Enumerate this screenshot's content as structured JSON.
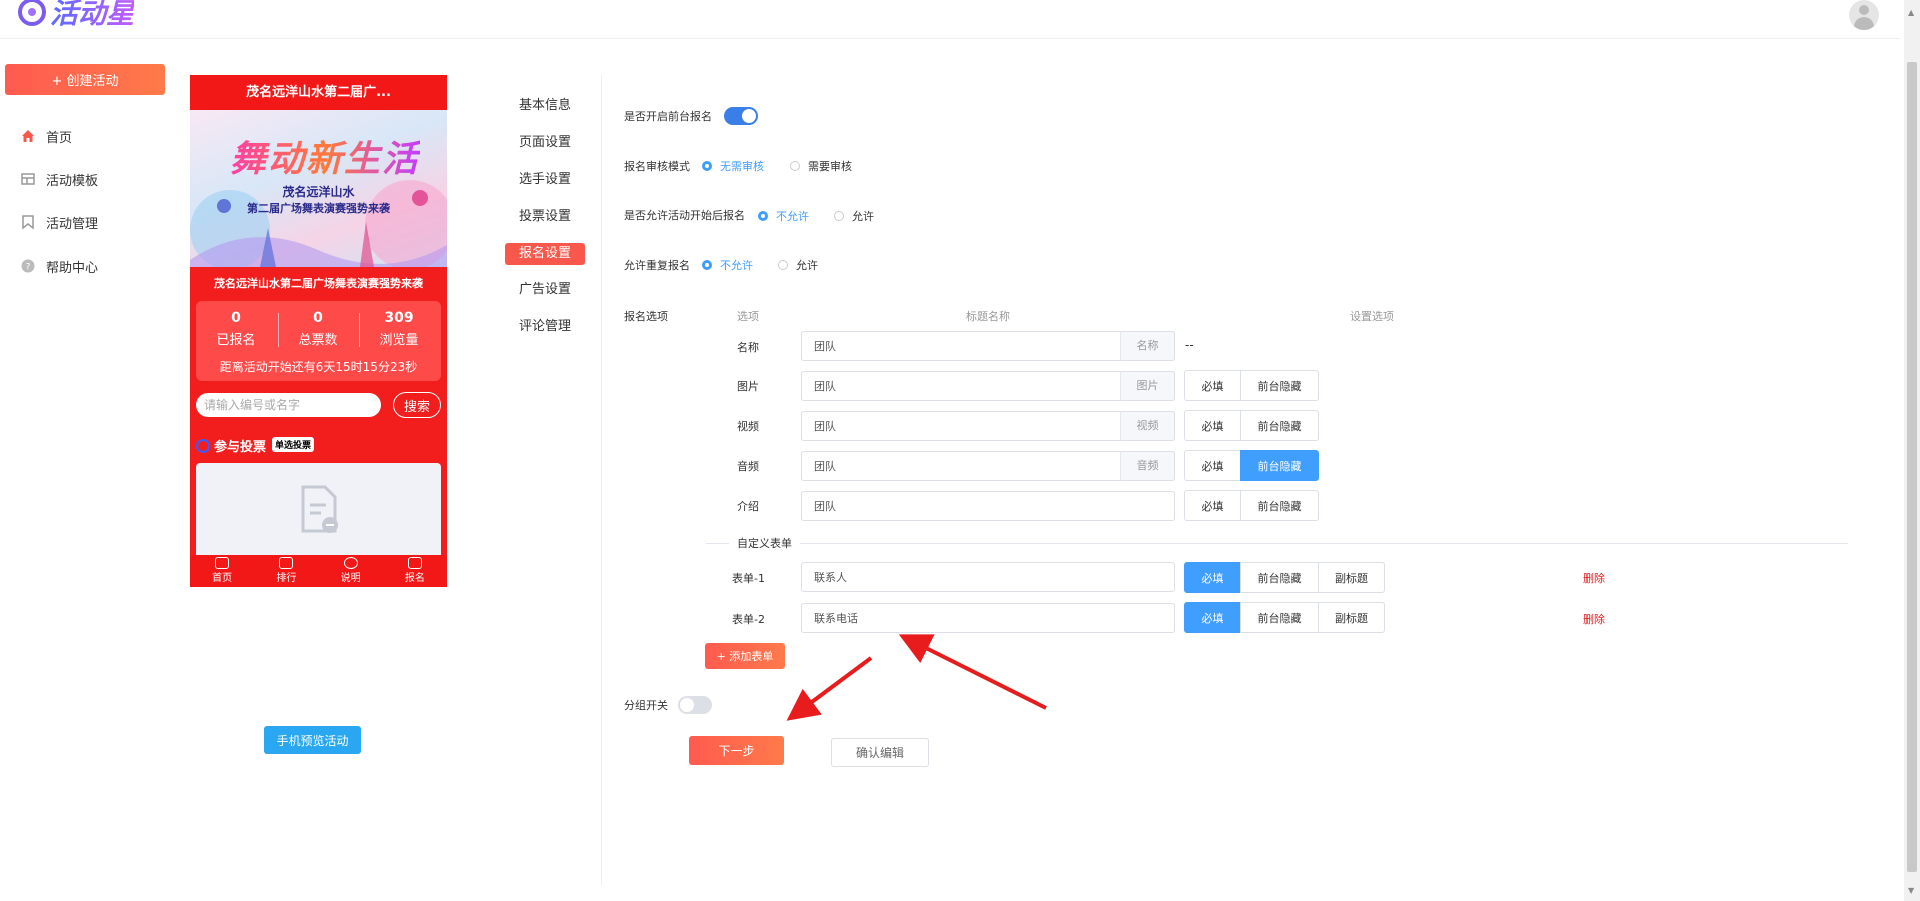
{
  "app": {
    "logo_text": "活动星"
  },
  "sidebar": {
    "create_button": "+ 创建活动",
    "items": [
      {
        "label": "首页",
        "icon": "home-icon"
      },
      {
        "label": "活动模板",
        "icon": "template-icon"
      },
      {
        "label": "活动管理",
        "icon": "bookmark-icon"
      },
      {
        "label": "帮助中心",
        "icon": "help-icon"
      }
    ]
  },
  "preview": {
    "title": "茂名远洋山水第二届广...",
    "banner_slogan": "舞动新生活",
    "banner_line1": "茂名远洋山水",
    "banner_line2": "第二届广场舞表演赛强势来袭",
    "event_name": "茂名远洋山水第二届广场舞表演赛强势来袭",
    "stats": [
      {
        "value": "0",
        "label": "已报名"
      },
      {
        "value": "0",
        "label": "总票数"
      },
      {
        "value": "309",
        "label": "浏览量"
      }
    ],
    "countdown": "距离活动开始还有6天15时15分23秒",
    "search_placeholder": "请输入编号或名字",
    "search_button": "搜索",
    "vote_title": "参与投票",
    "vote_tag": "单选投票",
    "tabs": [
      "首页",
      "排行",
      "说明",
      "报名"
    ],
    "preview_button": "手机预览活动"
  },
  "settings_menu": {
    "items": [
      "基本信息",
      "页面设置",
      "选手设置",
      "投票设置",
      "报名设置",
      "广告设置",
      "评论管理"
    ],
    "active": "报名设置"
  },
  "form": {
    "frontend_signup": {
      "label": "是否开启前台报名",
      "enabled": true
    },
    "review_mode": {
      "label": "报名审核模式",
      "options": [
        "无需审核",
        "需要审核"
      ],
      "selected": "无需审核"
    },
    "allow_after_start": {
      "label": "是否允许活动开始后报名",
      "options": [
        "不允许",
        "允许"
      ],
      "selected": "不允许"
    },
    "allow_repeat": {
      "label": "允许重复报名",
      "options": [
        "不允许",
        "允许"
      ],
      "selected": "不允许"
    },
    "options_label": "报名选项",
    "col_option": "选项",
    "col_title": "标题名称",
    "col_settings": "设置选项",
    "rows": [
      {
        "label": "名称",
        "value": "团队",
        "suffix": "名称",
        "extra": "--"
      },
      {
        "label": "图片",
        "value": "团队",
        "suffix": "图片",
        "required": "必填",
        "hide": "前台隐藏",
        "hide_on": false
      },
      {
        "label": "视频",
        "value": "团队",
        "suffix": "视频",
        "required": "必填",
        "hide": "前台隐藏",
        "hide_on": false
      },
      {
        "label": "音频",
        "value": "团队",
        "suffix": "音频",
        "required": "必填",
        "hide": "前台隐藏",
        "hide_on": true
      },
      {
        "label": "介绍",
        "value": "团队",
        "required": "必填",
        "hide": "前台隐藏",
        "hide_on": false
      }
    ],
    "custom_divider": "自定义表单",
    "custom_rows": [
      {
        "label": "表单-1",
        "value": "联系人",
        "required": "必填",
        "hide": "前台隐藏",
        "subtitle": "副标题",
        "delete": "删除"
      },
      {
        "label": "表单-2",
        "value": "联系电话",
        "required": "必填",
        "hide": "前台隐藏",
        "subtitle": "副标题",
        "delete": "删除"
      }
    ],
    "add_form_button": "+ 添加表单",
    "group_switch": {
      "label": "分组开关",
      "enabled": false
    },
    "next_button": "下一步",
    "confirm_button": "确认编辑"
  },
  "colors": {
    "accent": "#f7584b",
    "primary_blue": "#409eff",
    "phone_red": "#f21e1e",
    "arrow": "#e81c1c"
  }
}
